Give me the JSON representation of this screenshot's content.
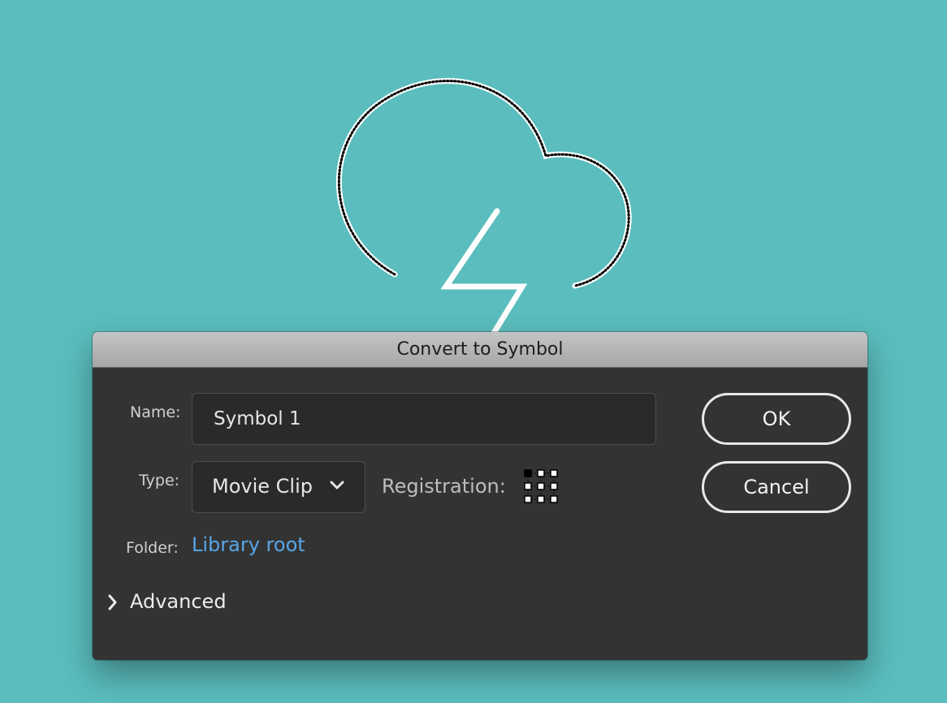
{
  "dialog": {
    "title": "Convert to Symbol",
    "name_label": "Name:",
    "name_value": "Symbol 1",
    "type_label": "Type:",
    "type_value": "Movie Clip",
    "registration_label": "Registration:",
    "folder_label": "Folder:",
    "folder_value": "Library root",
    "advanced_label": "Advanced",
    "ok_label": "OK",
    "cancel_label": "Cancel"
  },
  "icons": {
    "type_dropdown": "chevron-down-icon",
    "advanced_toggle": "chevron-right-icon",
    "registration": "registration-grid-icon",
    "artwork": "cloud-lightning-icon"
  },
  "colors": {
    "background": "#5bbdbd",
    "dialog": "#333333",
    "link": "#58a6e8",
    "button_border": "#e8e8e8"
  }
}
